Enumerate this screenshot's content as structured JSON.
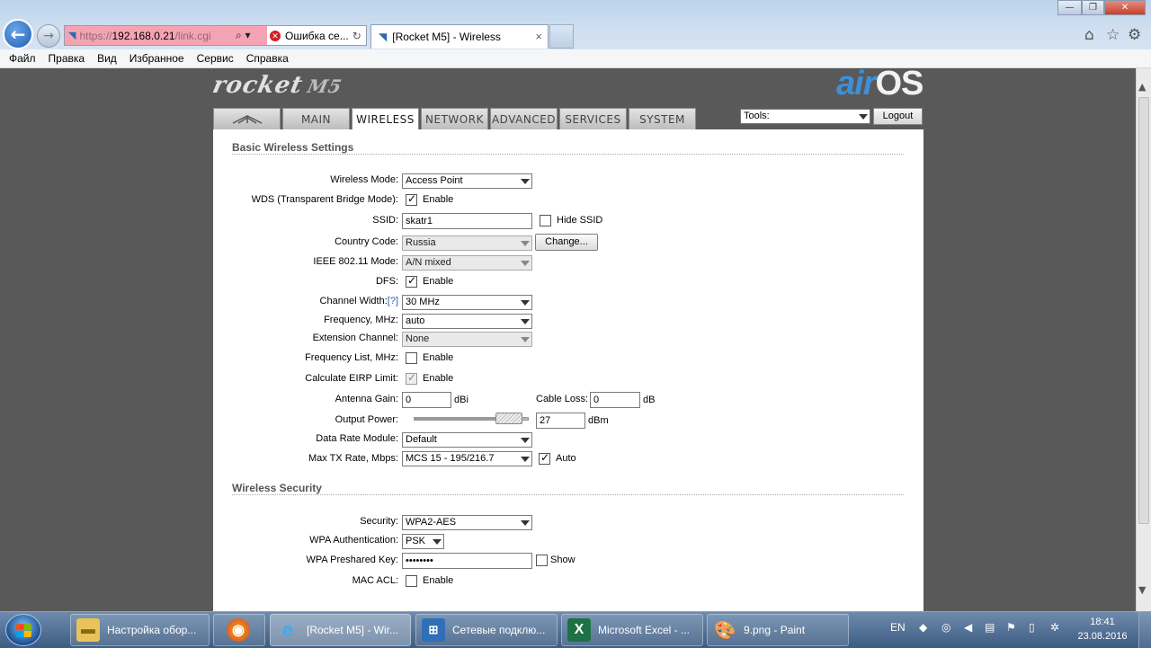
{
  "browser": {
    "address": {
      "prefix": "https://",
      "host": "192.168.0.21",
      "path": "/link.cgi"
    },
    "error_tab": "Ошибка се...",
    "active_tab": "[Rocket M5] - Wireless",
    "tab_close": "×"
  },
  "menu": [
    "Файл",
    "Правка",
    "Вид",
    "Избранное",
    "Сервис",
    "Справка"
  ],
  "header": {
    "product": "rocket",
    "model": "M5",
    "os_air": "air",
    "os_os": "OS",
    "os_tm": "™"
  },
  "tabs": [
    "MAIN",
    "WIRELESS",
    "NETWORK",
    "ADVANCED",
    "SERVICES",
    "SYSTEM"
  ],
  "active_tab": "WIRELESS",
  "tools": {
    "selected": "Tools:",
    "logout": "Logout"
  },
  "basic": {
    "title": "Basic Wireless Settings",
    "wireless_mode": {
      "label": "Wireless Mode:",
      "value": "Access Point"
    },
    "wds": {
      "label": "WDS (Transparent Bridge Mode):",
      "checked": true,
      "text": "Enable"
    },
    "ssid": {
      "label": "SSID:",
      "value": "skatr1",
      "hide_text": "Hide SSID",
      "hide_checked": false
    },
    "country": {
      "label": "Country Code:",
      "value": "Russia",
      "button": "Change..."
    },
    "ieee": {
      "label": "IEEE 802.11 Mode:",
      "value": "A/N mixed"
    },
    "dfs": {
      "label": "DFS:",
      "checked": true,
      "text": "Enable"
    },
    "channel_width": {
      "label": "Channel Width:",
      "help": "[?]",
      "value": "30 MHz"
    },
    "frequency": {
      "label": "Frequency, MHz:",
      "value": "auto"
    },
    "extension": {
      "label": "Extension Channel:",
      "value": "None"
    },
    "freq_list": {
      "label": "Frequency List, MHz:",
      "checked": false,
      "text": "Enable"
    },
    "eirp": {
      "label": "Calculate EIRP Limit:",
      "checked": true,
      "text": "Enable"
    },
    "antenna_gain": {
      "label": "Antenna Gain:",
      "value": "0",
      "unit": "dBi"
    },
    "cable_loss": {
      "label": "Cable Loss:",
      "value": "0",
      "unit": "dB"
    },
    "output_power": {
      "label": "Output Power:",
      "value": "27",
      "unit": "dBm",
      "slider_level": 0.94
    },
    "data_rate": {
      "label": "Data Rate Module:",
      "value": "Default"
    },
    "max_tx": {
      "label": "Max TX Rate, Mbps:",
      "value": "MCS 15 - 195/216.7",
      "auto_checked": true,
      "auto_text": "Auto"
    }
  },
  "security": {
    "title": "Wireless Security",
    "security": {
      "label": "Security:",
      "value": "WPA2-AES"
    },
    "wpa_auth": {
      "label": "WPA Authentication:",
      "value": "PSK"
    },
    "psk": {
      "label": "WPA Preshared Key:",
      "value": "••••••••",
      "show_text": "Show",
      "show_checked": false
    },
    "mac_acl": {
      "label": "MAC ACL:",
      "checked": false,
      "text": "Enable"
    }
  },
  "taskbar": {
    "items": [
      {
        "label": "Настройка обор...",
        "icon": "folder-icon"
      },
      {
        "label": "",
        "icon": "firefox-icon"
      },
      {
        "label": "[Rocket M5] - Wir...",
        "icon": "ie-icon"
      },
      {
        "label": "Сетевые подклю...",
        "icon": "network-icon"
      },
      {
        "label": "Microsoft Excel - ...",
        "icon": "excel-icon"
      },
      {
        "label": "9.png - Paint",
        "icon": "paint-icon"
      }
    ],
    "lang": "EN",
    "time": "18:41",
    "date": "23.08.2016"
  },
  "colors": {
    "airos_blue": "#3e8fd6",
    "page_bg": "#595959",
    "help_link": "#2a62b6"
  }
}
